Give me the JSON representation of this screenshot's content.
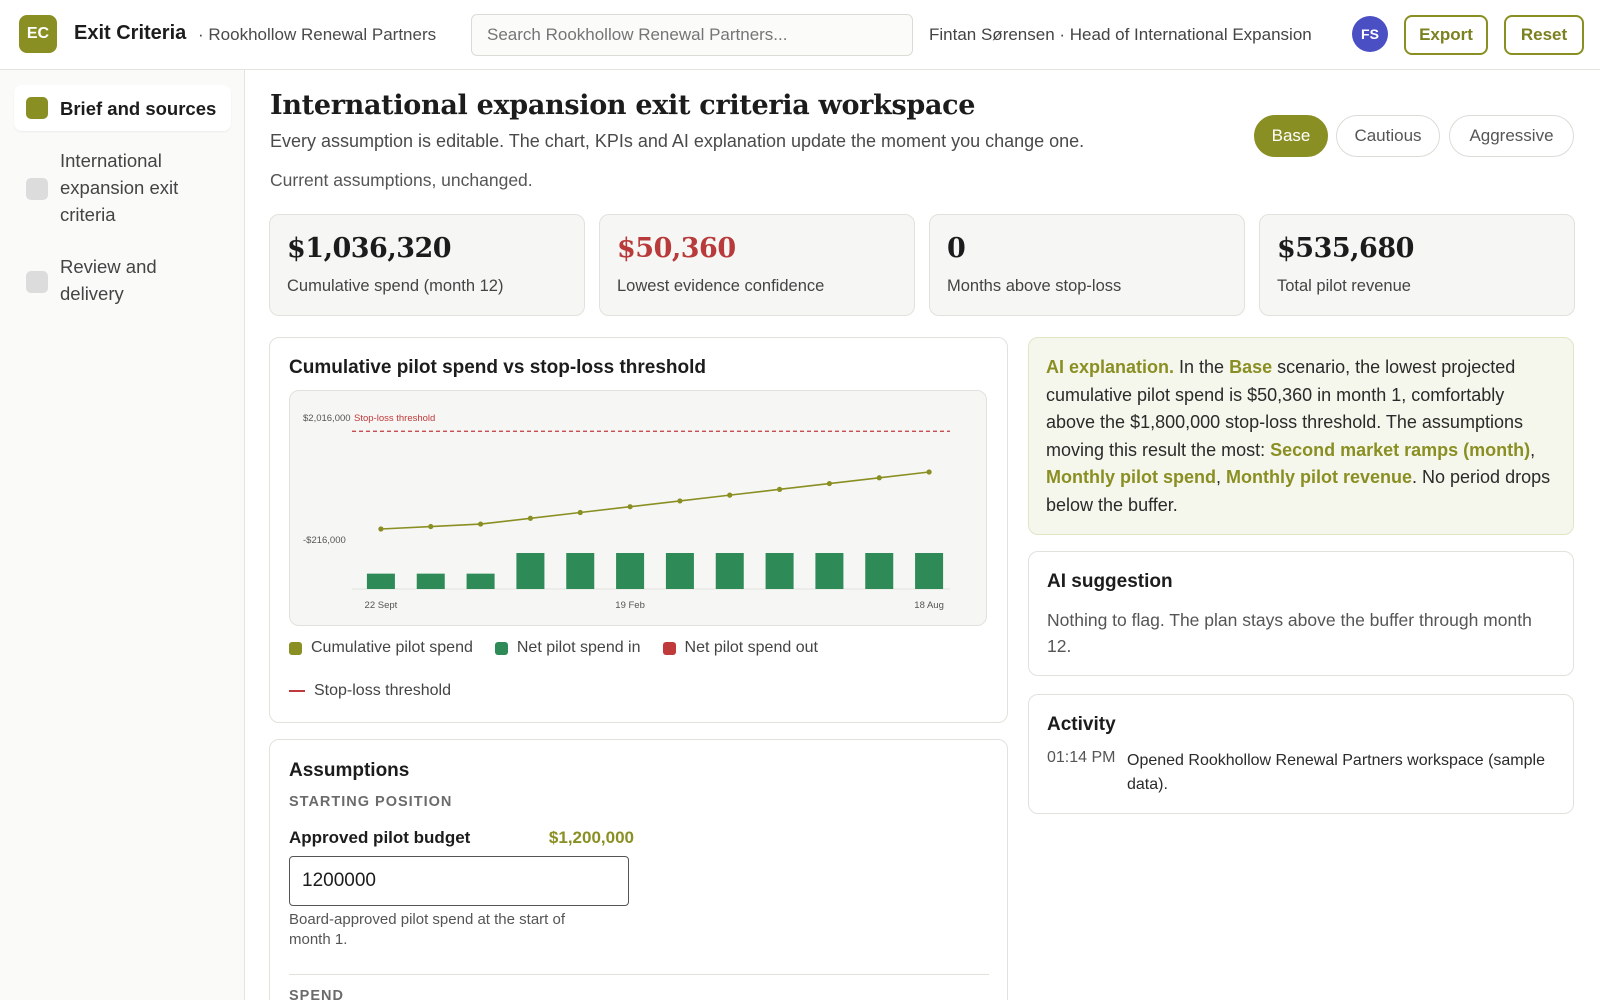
{
  "app": {
    "logo": "EC",
    "title": "Exit Criteria",
    "org": "· Rookhollow Renewal Partners",
    "search_placeholder": "Search Rookhollow Renewal Partners...",
    "user": "Fintan Sørensen · Head of International Expansion",
    "avatar": "FS",
    "export_label": "Export",
    "reset_label": "Reset"
  },
  "sidebar": {
    "items": [
      {
        "label": "Brief and sources",
        "active": true
      },
      {
        "label": "International expansion exit criteria",
        "active": false
      },
      {
        "label": "Review and delivery",
        "active": false
      }
    ]
  },
  "page": {
    "title": "International expansion exit criteria workspace",
    "subtitle": "Every assumption is editable. The chart, KPIs and AI explanation update the moment you change one.",
    "status": "Current assumptions, unchanged.",
    "scenarios": [
      "Base",
      "Cautious",
      "Aggressive"
    ],
    "active_scenario": "Base"
  },
  "kpis": [
    {
      "value": "$1,036,320",
      "label": "Cumulative spend (month 12)",
      "negative": false
    },
    {
      "value": "$50,360",
      "label": "Lowest evidence confidence",
      "negative": true
    },
    {
      "value": "0",
      "label": "Months above stop-loss",
      "negative": false
    },
    {
      "value": "$535,680",
      "label": "Total pilot revenue",
      "negative": false
    }
  ],
  "chart_title": "Cumulative pilot spend vs stop-loss threshold",
  "chart_data": {
    "type": "bar",
    "title": "Cumulative pilot spend vs stop-loss threshold",
    "x_tick_labels": [
      "22 Sept",
      "19 Feb",
      "18 Aug"
    ],
    "y_tick_labels": [
      "$2,016,000",
      "-$216,000"
    ],
    "ylim": [
      -216000,
      2016000
    ],
    "threshold": {
      "label": "Stop-loss threshold",
      "value": 1800000
    },
    "series": [
      {
        "name": "Cumulative pilot spend",
        "type": "line",
        "color": "#8a8f23",
        "values": [
          50360,
          100720,
          151080,
          269160,
          387240,
          505320,
          623400,
          741480,
          859560,
          977640,
          1095720,
          1213800
        ]
      },
      {
        "name": "Net pilot spend in",
        "type": "bar",
        "color": "#2e8a57",
        "values": [
          50360,
          50360,
          50360,
          118080,
          118080,
          118080,
          118080,
          118080,
          118080,
          118080,
          118080,
          118080
        ]
      },
      {
        "name": "Net pilot spend out",
        "type": "bar",
        "color": "#c0393b",
        "values": []
      }
    ],
    "legend": [
      {
        "name": "Cumulative pilot spend",
        "color": "#8a8f23",
        "kind": "swatch"
      },
      {
        "name": "Net pilot spend in",
        "color": "#2e8a57",
        "kind": "swatch"
      },
      {
        "name": "Net pilot spend out",
        "color": "#c0393b",
        "kind": "swatch"
      },
      {
        "name": "Stop-loss threshold",
        "color": "#c0393b",
        "kind": "line"
      }
    ]
  },
  "ai": {
    "lead": "AI explanation.",
    "t1": " In the ",
    "scenario": "Base",
    "t2": " scenario, the lowest projected cumulative pilot spend is $50,360 in month 1, comfortably above the $1,800,000 stop-loss threshold. The assumptions moving this result the most: ",
    "driver1": "Second market ramps (month)",
    "sep1": ", ",
    "driver2": "Monthly pilot spend",
    "sep2": ", ",
    "driver3": "Monthly pilot revenue",
    "t3": ". No period drops below the buffer."
  },
  "suggestion": {
    "title": "AI suggestion",
    "text": "Nothing to flag. The plan stays above the buffer through month 12."
  },
  "activity": {
    "title": "Activity",
    "time": "01:14 PM",
    "text": "Opened Rookhollow Renewal Partners workspace (sample data)."
  },
  "assumptions": {
    "title": "Assumptions",
    "section1": "STARTING POSITION",
    "field_label": "Approved pilot budget",
    "field_display": "$1,200,000",
    "field_value": "1200000",
    "field_help": "Board-approved pilot spend at the start of month 1.",
    "section2": "SPEND"
  },
  "colors": {
    "accent": "#8a8f23",
    "positive_bar": "#2e8a57",
    "negative": "#c0393b",
    "avatar": "#4b4fc4"
  }
}
